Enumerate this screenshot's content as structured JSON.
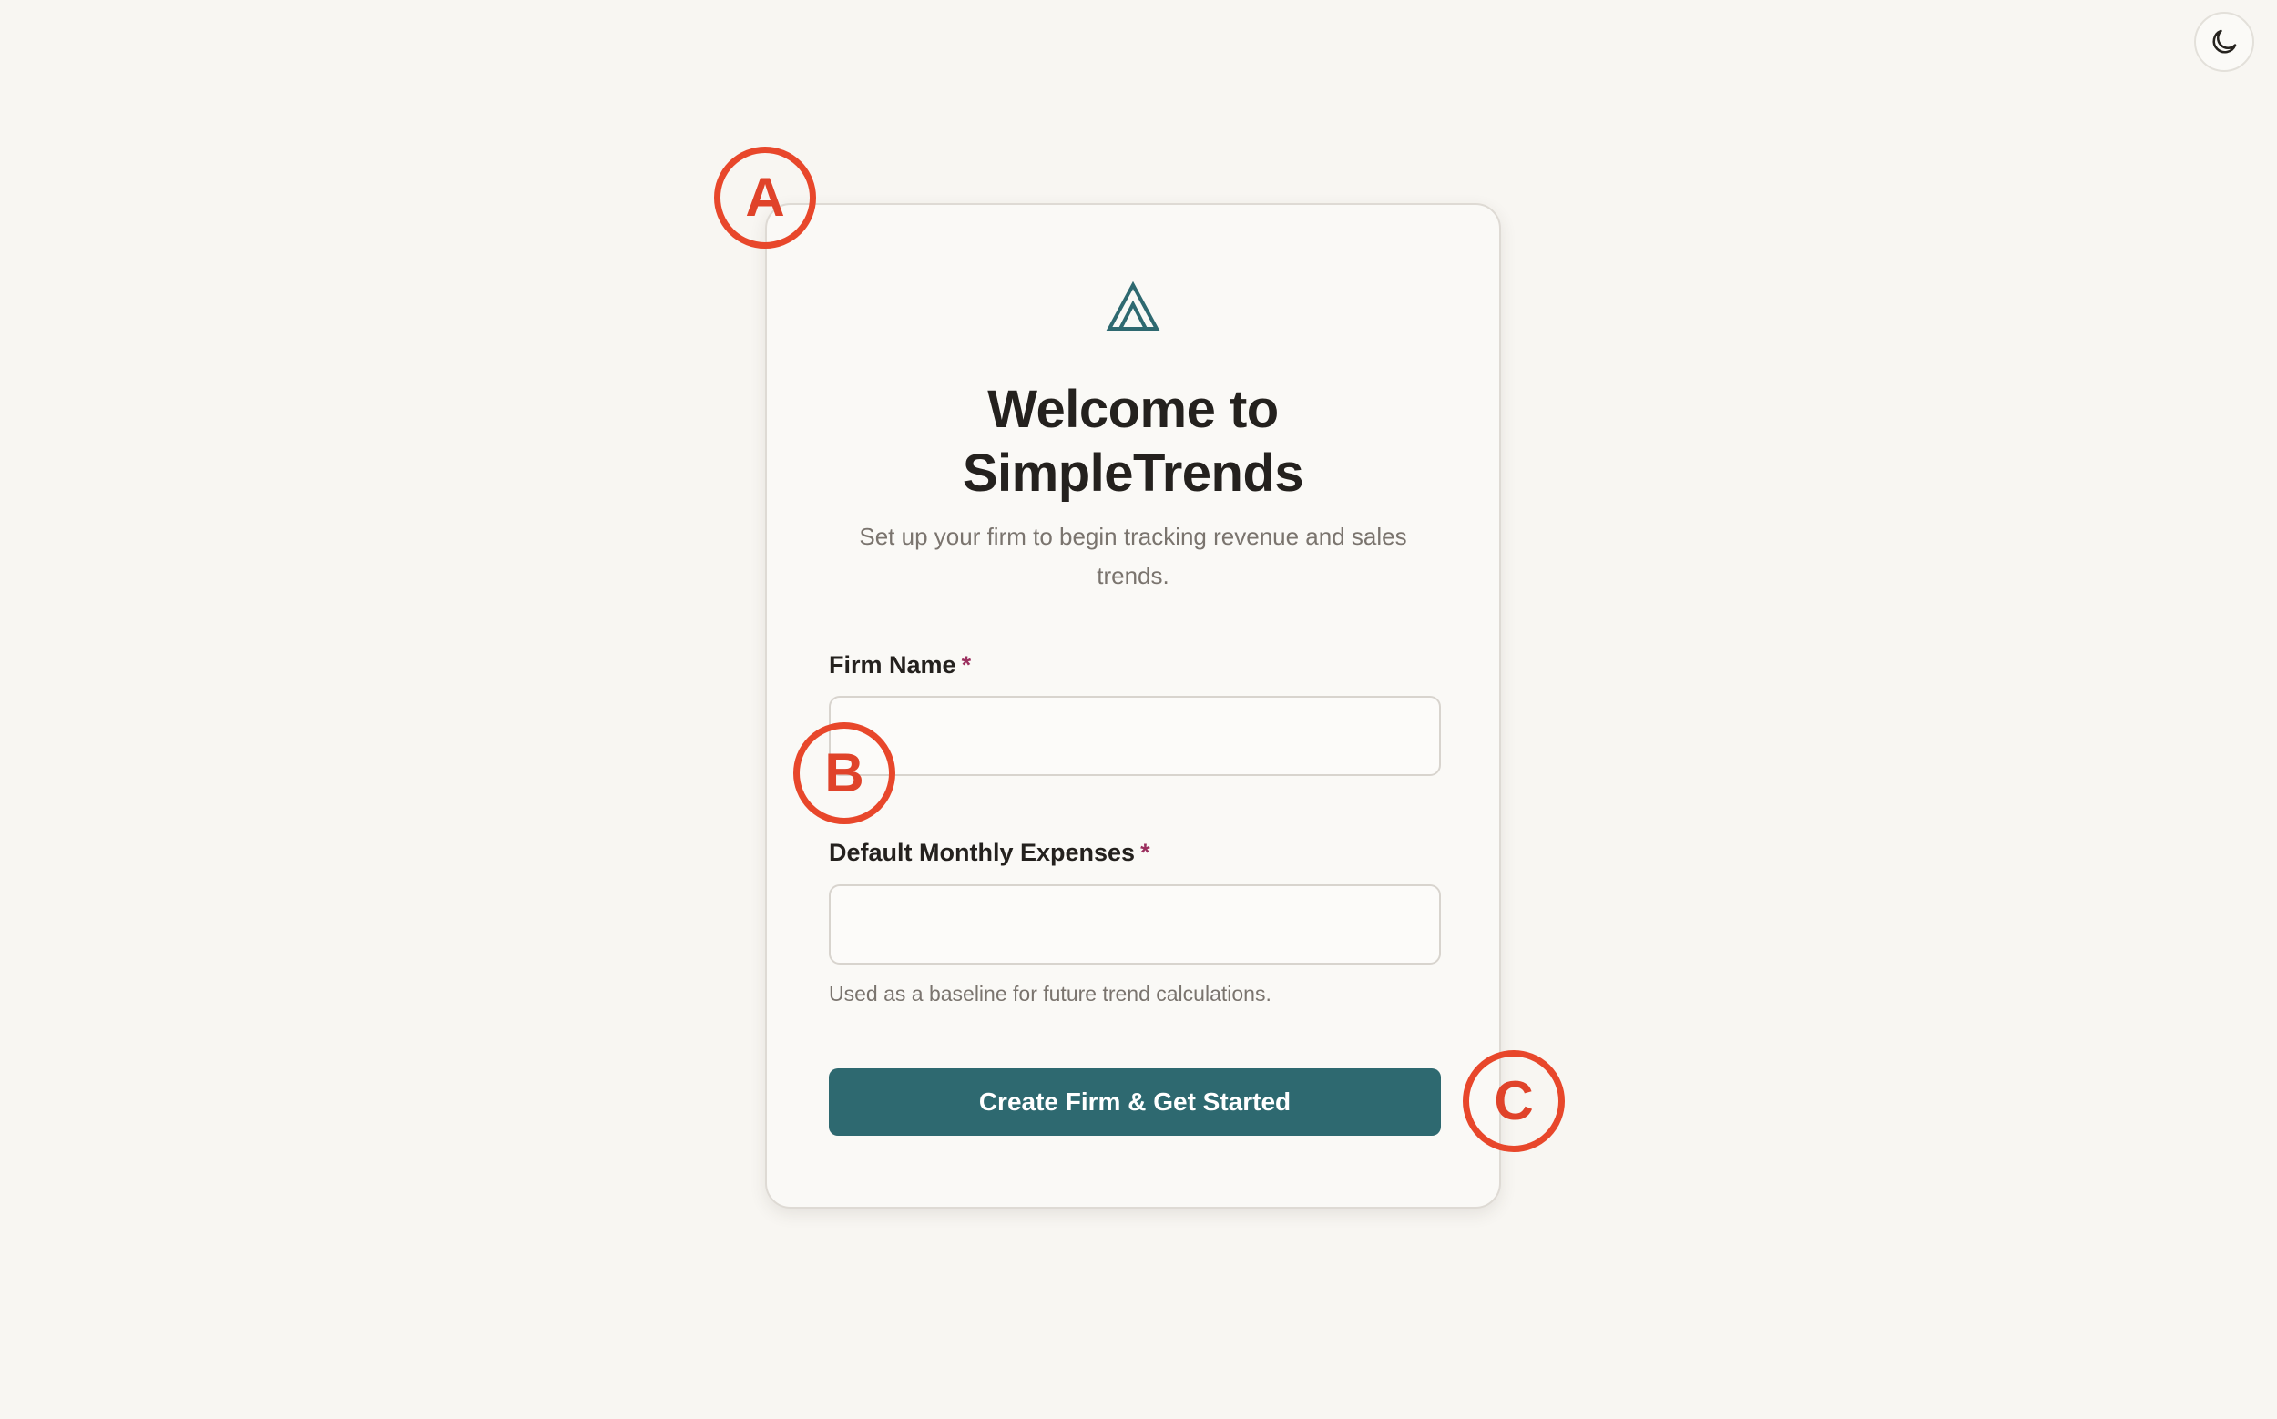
{
  "theme_toggle": {
    "icon": "moon-icon"
  },
  "card": {
    "logo_icon": "triangle-logo-icon",
    "title_line1": "Welcome to",
    "title_line2": "SimpleTrends",
    "subtitle": "Set up your firm to begin tracking revenue and sales trends."
  },
  "form": {
    "firm_name": {
      "label": "Firm Name",
      "required_mark": "*",
      "value": ""
    },
    "monthly_expenses": {
      "label": "Default Monthly Expenses",
      "required_mark": "*",
      "value": "",
      "help": "Used as a baseline for future trend calculations."
    },
    "submit_label": "Create Firm & Get Started"
  },
  "markers": {
    "a": "A",
    "b": "B",
    "c": "C"
  },
  "colors": {
    "background": "#f8f6f2",
    "accent": "#2e6970",
    "required": "#9b2f5e",
    "marker": "#e8472b"
  }
}
